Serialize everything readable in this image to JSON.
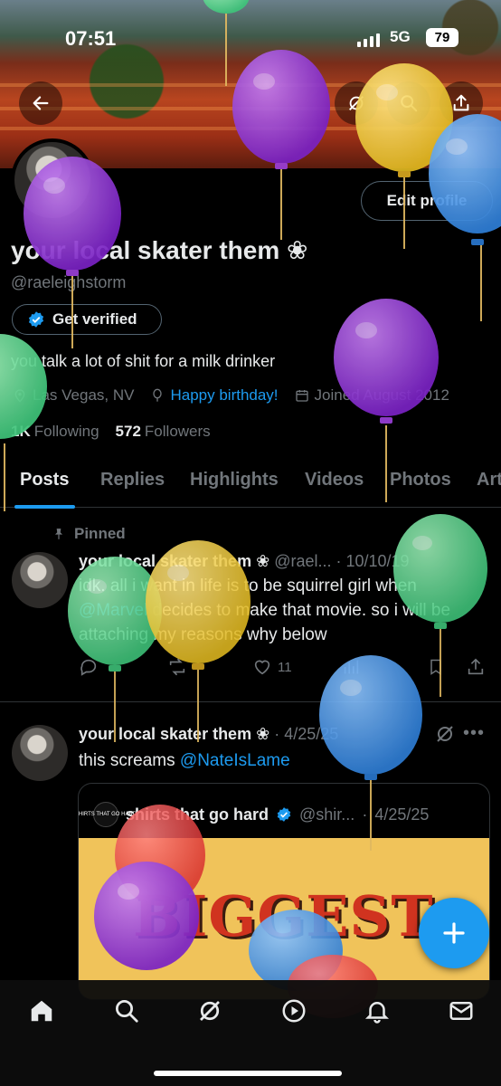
{
  "status_bar": {
    "time": "07:51",
    "network": "5G",
    "battery": "79"
  },
  "header": {
    "back_icon": "arrow-left-icon",
    "actions": [
      "grok-icon",
      "search-icon",
      "share-icon"
    ]
  },
  "profile": {
    "edit_label": "Edit profile",
    "display_name": "your local skater them ❀",
    "handle": "@raeleighstorm",
    "verify_label": "Get verified",
    "bio": "you talk a lot of shit for a milk drinker",
    "location": "Las Vegas, NV",
    "birthday": "Happy birthday!",
    "joined": "Joined August 2012",
    "following_count": "1K",
    "following_label": "Following",
    "followers_count": "572",
    "followers_label": "Followers"
  },
  "tabs": [
    "Posts",
    "Replies",
    "Highlights",
    "Videos",
    "Photos",
    "Art"
  ],
  "active_tab": "Posts",
  "posts": [
    {
      "pinned_label": "Pinned",
      "name": "your local skater them ❀",
      "handle": "@rael...",
      "date": "10/10/19",
      "text_before": "idk. all i want in life is to be squirrel girl when ",
      "mention": "@Marvel",
      "text_after": " decides to make that movie. so i will be attaching my reasons why below",
      "likes": "11"
    },
    {
      "name": "your local skater them ❀",
      "date": "4/25/25",
      "text_before": "this screams ",
      "mention": "@NateIsLame",
      "quote": {
        "logo_text": "SHIRTS THAT GO HARD",
        "name": "shirts that go hard",
        "handle": "@shir...",
        "date": "4/25/25",
        "image_text": "BIGGEST"
      }
    }
  ],
  "fab_icon": "plus-icon",
  "bottom_nav": [
    "home-icon",
    "search-icon",
    "grok-icon",
    "play-icon",
    "bell-icon",
    "mail-icon"
  ],
  "colors": {
    "accent": "#1d9bf0",
    "text": "#e7e9ea",
    "muted": "#71767b",
    "border": "#2f3336",
    "background": "#000000"
  }
}
